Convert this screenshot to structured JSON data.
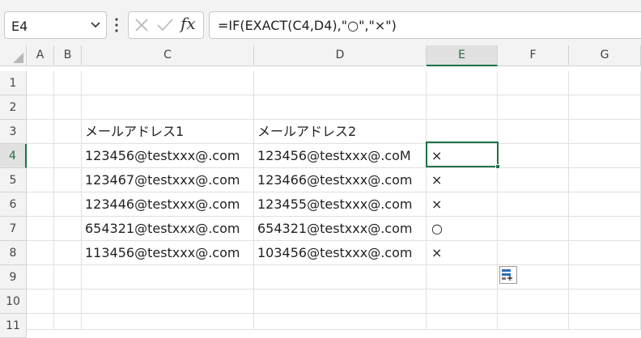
{
  "namebox": {
    "value": "E4"
  },
  "formula": {
    "text": "=IF(EXACT(C4,D4),\"○\",\"×\")"
  },
  "columns": [
    "A",
    "B",
    "C",
    "D",
    "E",
    "F",
    "G"
  ],
  "rows": [
    "1",
    "2",
    "3",
    "4",
    "5",
    "6",
    "7",
    "8",
    "9",
    "10",
    "11"
  ],
  "cells": {
    "C3": "メールアドレス1",
    "D3": "メールアドレス2",
    "C4": "123456@testxxx@.com",
    "D4": "123456@testxxx@.coM",
    "E4": "×",
    "C5": "123467@testxxx@.com",
    "D5": "123466@testxxx@.com",
    "E5": "×",
    "C6": "123446@testxxx@.com",
    "D6": "123455@testxxx@.com",
    "E6": "×",
    "C7": "654321@testxxx@.com",
    "D7": "654321@testxxx@.com",
    "E7": "○",
    "C8": "113456@testxxx@.com",
    "D8": "103456@testxxx@.com",
    "E8": "×"
  },
  "selection": {
    "cell": "E4"
  },
  "colors": {
    "accent": "#1e7145"
  },
  "icons": {
    "namebox_dropdown": "chevron-down-icon",
    "more": "vertical-dots-icon",
    "cancel": "close-icon",
    "enter": "check-icon",
    "function": "fx-icon",
    "paste_options": "paste-options-icon"
  }
}
